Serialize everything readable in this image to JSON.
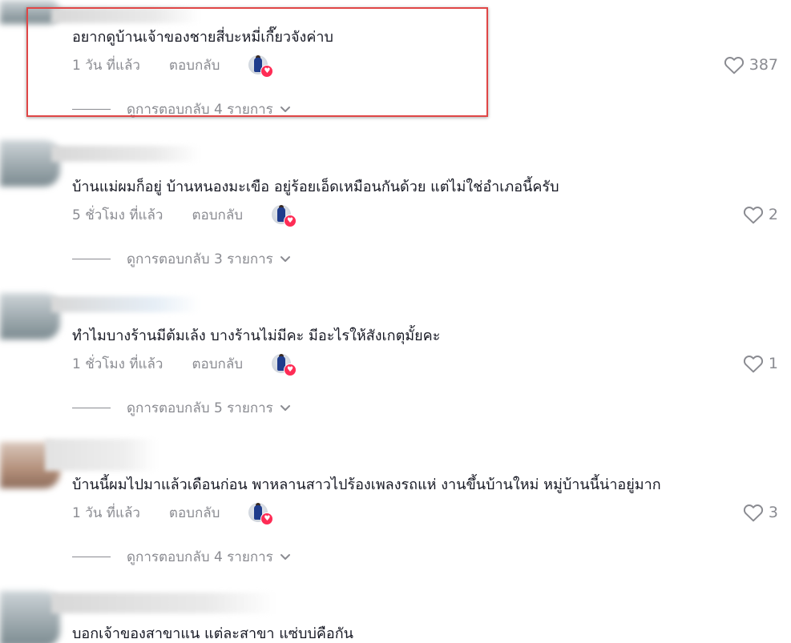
{
  "comments": [
    {
      "text": "อยากดูบ้านเจ้าของชายสี่บะหมี่เกี๊ยวจังค่าบ",
      "time": "1 วัน ที่แล้ว",
      "reply_label": "ตอบกลับ",
      "likes": "387",
      "view_replies": "ดูการตอบกลับ 4 รายการ"
    },
    {
      "text": "บ้านแม่ผมก็อยู่ บ้านหนองมะเขือ อยู่ร้อยเอ็ดเหมือนกันด้วย แต่ไม่ใช่อำเภอนี้ครับ",
      "time": "5 ชั่วโมง ที่แล้ว",
      "reply_label": "ตอบกลับ",
      "likes": "2",
      "view_replies": "ดูการตอบกลับ 3 รายการ"
    },
    {
      "text": "ทำไมบางร้านมีต้มเล้ง บางร้านไม่มีคะ มีอะไรให้สังเกตุมั้ยคะ",
      "time": "1 ชั่วโมง ที่แล้ว",
      "reply_label": "ตอบกลับ",
      "likes": "1",
      "view_replies": "ดูการตอบกลับ 5 รายการ"
    },
    {
      "text": "บ้านนี้ผมไปมาแล้วเดือนก่อน พาหลานสาวไปร้องเพลงรถแห่ งานขึ้นบ้านใหม่ หมู่บ้านนี้น่าอยู่มาก",
      "time": "1 วัน ที่แล้ว",
      "reply_label": "ตอบกลับ",
      "likes": "3",
      "view_replies": "ดูการตอบกลับ 4 รายการ"
    },
    {
      "text": "บอกเจ้าของสาขาแน แต่ละสาขา แซ่บบ่คือกัน"
    }
  ],
  "colors": {
    "text": "#161823",
    "muted": "#8a8b91",
    "badge": "#fe2c55",
    "highlight": "#e04646"
  },
  "icons": {
    "like": "heart-outline-icon",
    "expand": "chevron-down-icon",
    "creator_badge": "heart-badge-icon"
  }
}
